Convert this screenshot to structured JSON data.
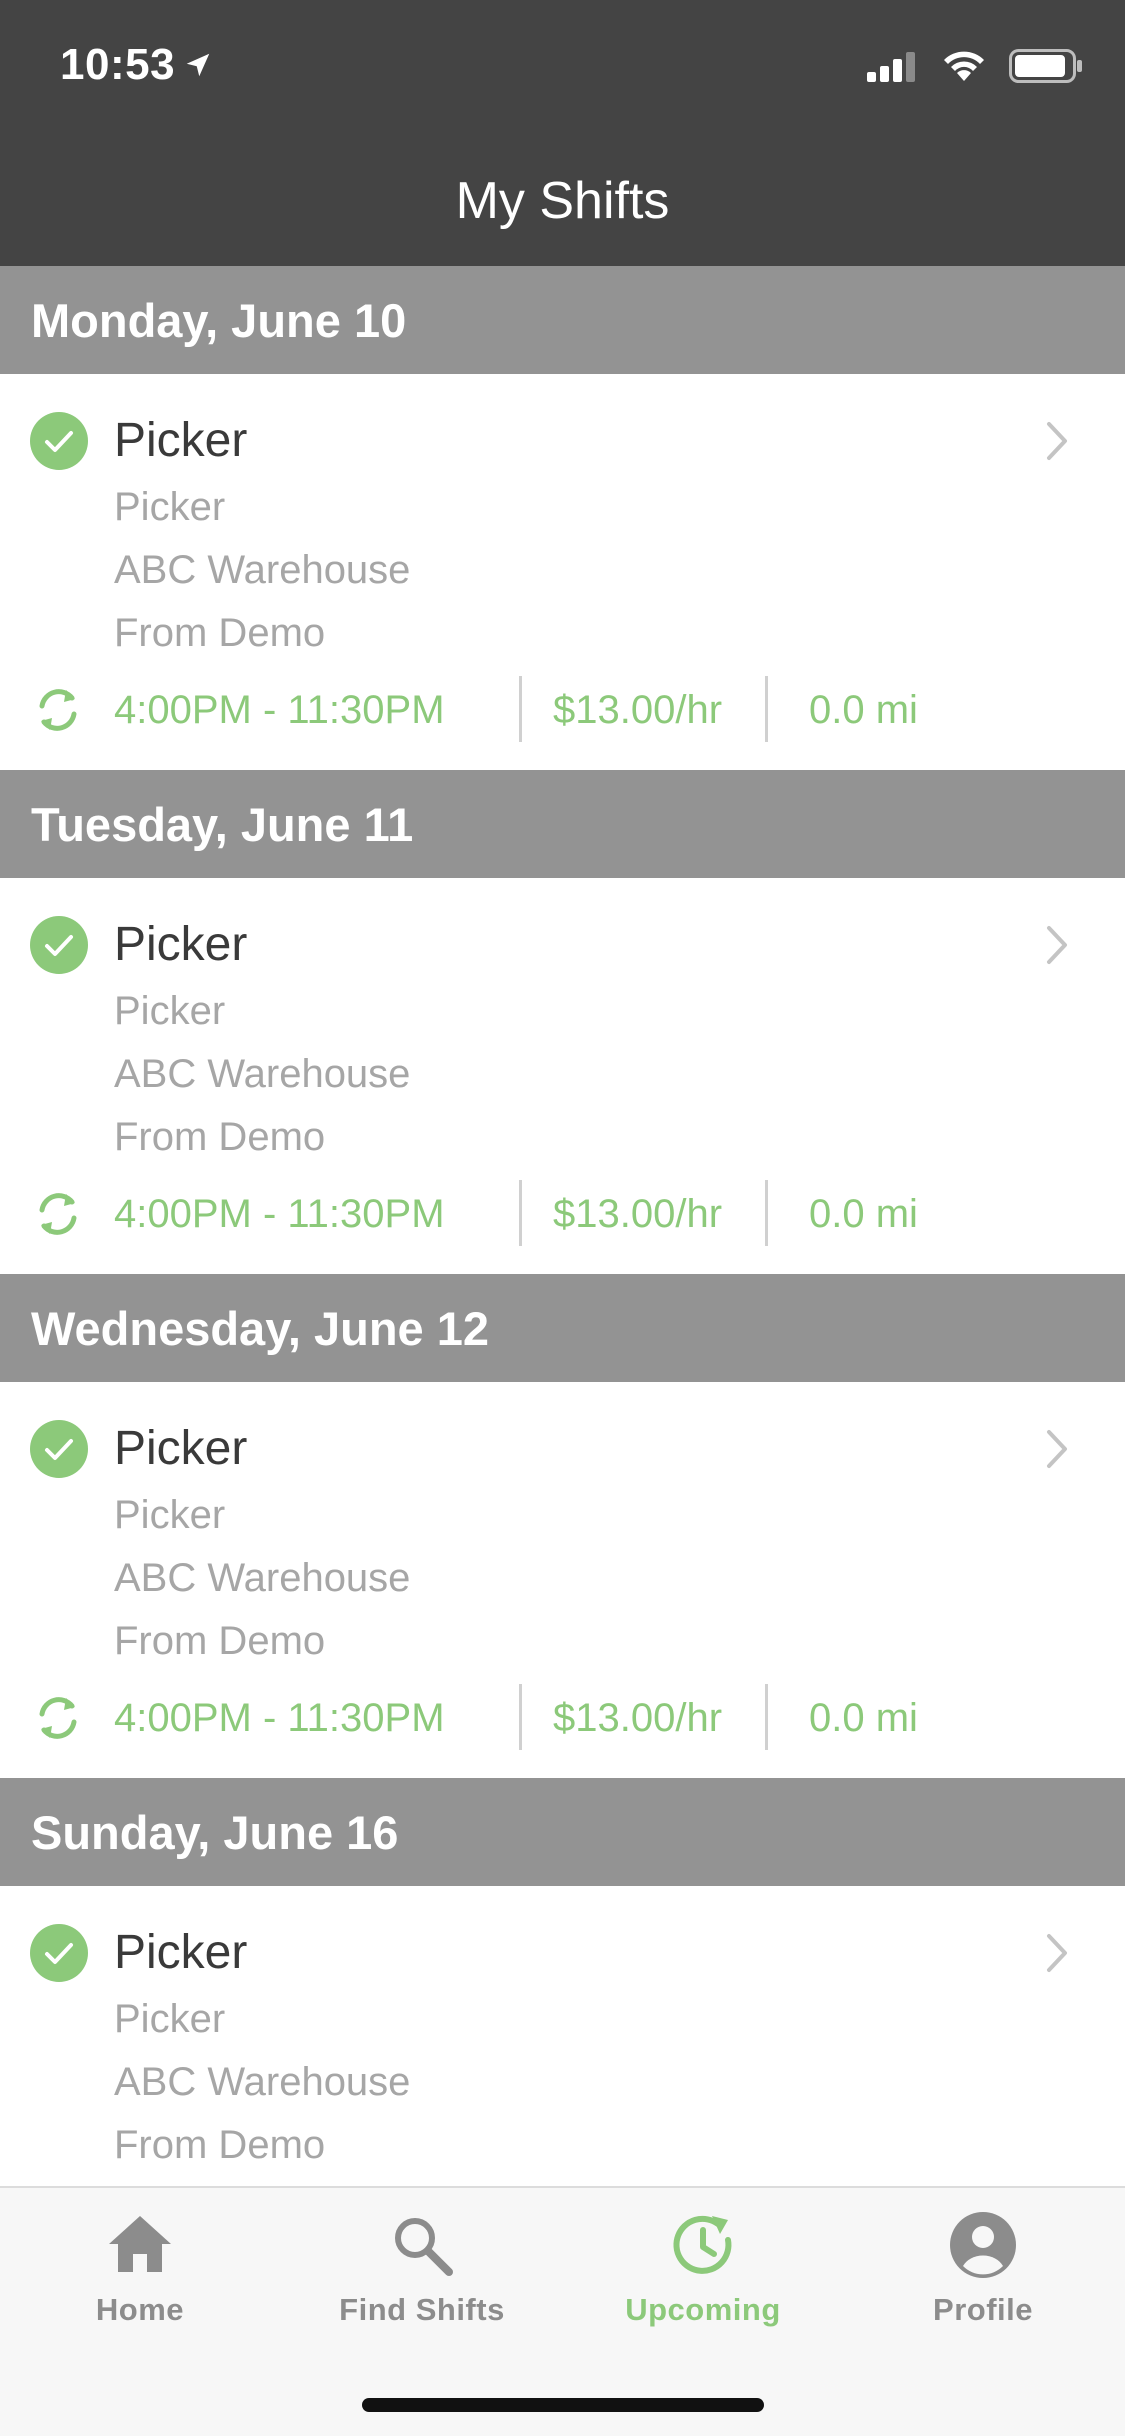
{
  "status_bar": {
    "time": "10:53",
    "location_icon": "location-arrow-icon",
    "signal_icon": "cellular-signal-icon",
    "wifi_icon": "wifi-icon",
    "battery_icon": "battery-icon"
  },
  "nav": {
    "title": "My Shifts"
  },
  "colors": {
    "header_bg": "#444444",
    "day_header_bg": "#939393",
    "accent_green": "#8cc97a",
    "muted_text": "#a6a6a6"
  },
  "days": [
    {
      "date_label": "Monday, June 10",
      "shift": {
        "title": "Picker",
        "role": "Picker",
        "location": "ABC Warehouse",
        "source": "From Demo",
        "time": "4:00PM - 11:30PM",
        "rate": "$13.00/hr",
        "distance": "0.0 mi"
      }
    },
    {
      "date_label": "Tuesday, June 11",
      "shift": {
        "title": "Picker",
        "role": "Picker",
        "location": "ABC Warehouse",
        "source": "From Demo",
        "time": "4:00PM - 11:30PM",
        "rate": "$13.00/hr",
        "distance": "0.0 mi"
      }
    },
    {
      "date_label": "Wednesday, June 12",
      "shift": {
        "title": "Picker",
        "role": "Picker",
        "location": "ABC Warehouse",
        "source": "From Demo",
        "time": "4:00PM - 11:30PM",
        "rate": "$13.00/hr",
        "distance": "0.0 mi"
      }
    },
    {
      "date_label": "Sunday, June 16",
      "shift": {
        "title": "Picker",
        "role": "Picker",
        "location": "ABC Warehouse",
        "source": "From Demo"
      }
    }
  ],
  "tabs": [
    {
      "label": "Home",
      "icon": "home-icon",
      "active": false
    },
    {
      "label": "Find Shifts",
      "icon": "search-icon",
      "active": false
    },
    {
      "label": "Upcoming",
      "icon": "upcoming-clock-icon",
      "active": true
    },
    {
      "label": "Profile",
      "icon": "profile-icon",
      "active": false
    }
  ]
}
